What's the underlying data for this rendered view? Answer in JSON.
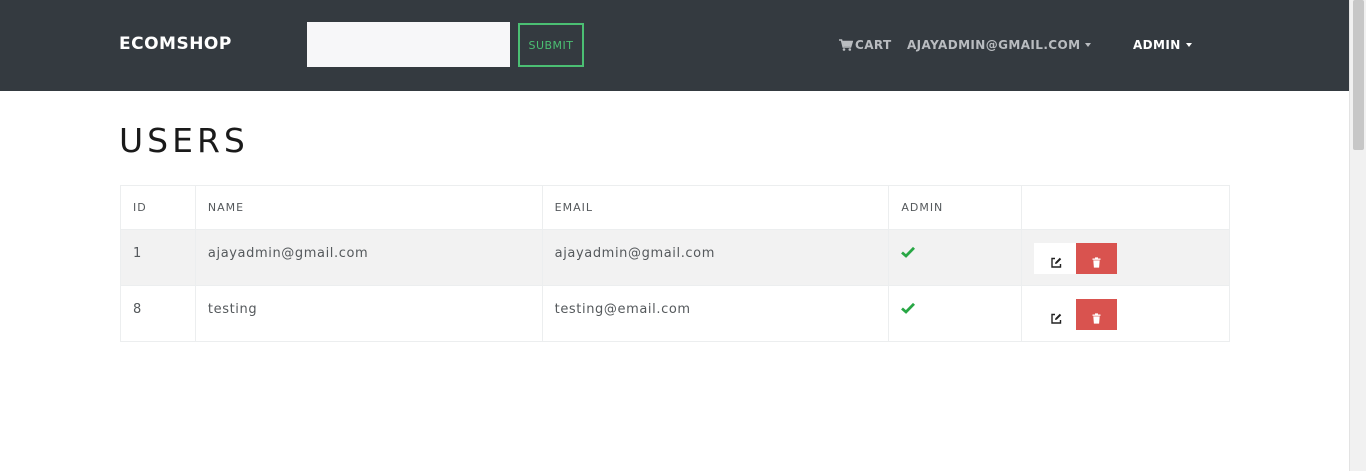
{
  "navbar": {
    "brand": "ECOMSHOP",
    "search": {
      "value": "",
      "placeholder": ""
    },
    "submit_label": "SUBMIT",
    "cart_label": "CART",
    "user_label": "AJAYADMIN@GMAIL.COM",
    "admin_label": "ADMIN"
  },
  "page": {
    "title": "USERS"
  },
  "table": {
    "headers": [
      "ID",
      "NAME",
      "EMAIL",
      "ADMIN",
      ""
    ],
    "rows": [
      {
        "id": "1",
        "name": "ajayadmin@gmail.com",
        "email": "ajayadmin@gmail.com",
        "admin": true
      },
      {
        "id": "8",
        "name": "testing",
        "email": "testing@email.com",
        "admin": true
      }
    ]
  },
  "icons": {
    "cart": "shopping-cart-icon",
    "admin_true": "check-icon",
    "edit": "edit-icon",
    "delete": "trash-icon"
  },
  "colors": {
    "navbar_bg": "#343a40",
    "submit_accent": "#4bbf73",
    "check_color": "#28a745",
    "delete_bg": "#d9534f",
    "stripe_bg": "#f2f2f2"
  }
}
